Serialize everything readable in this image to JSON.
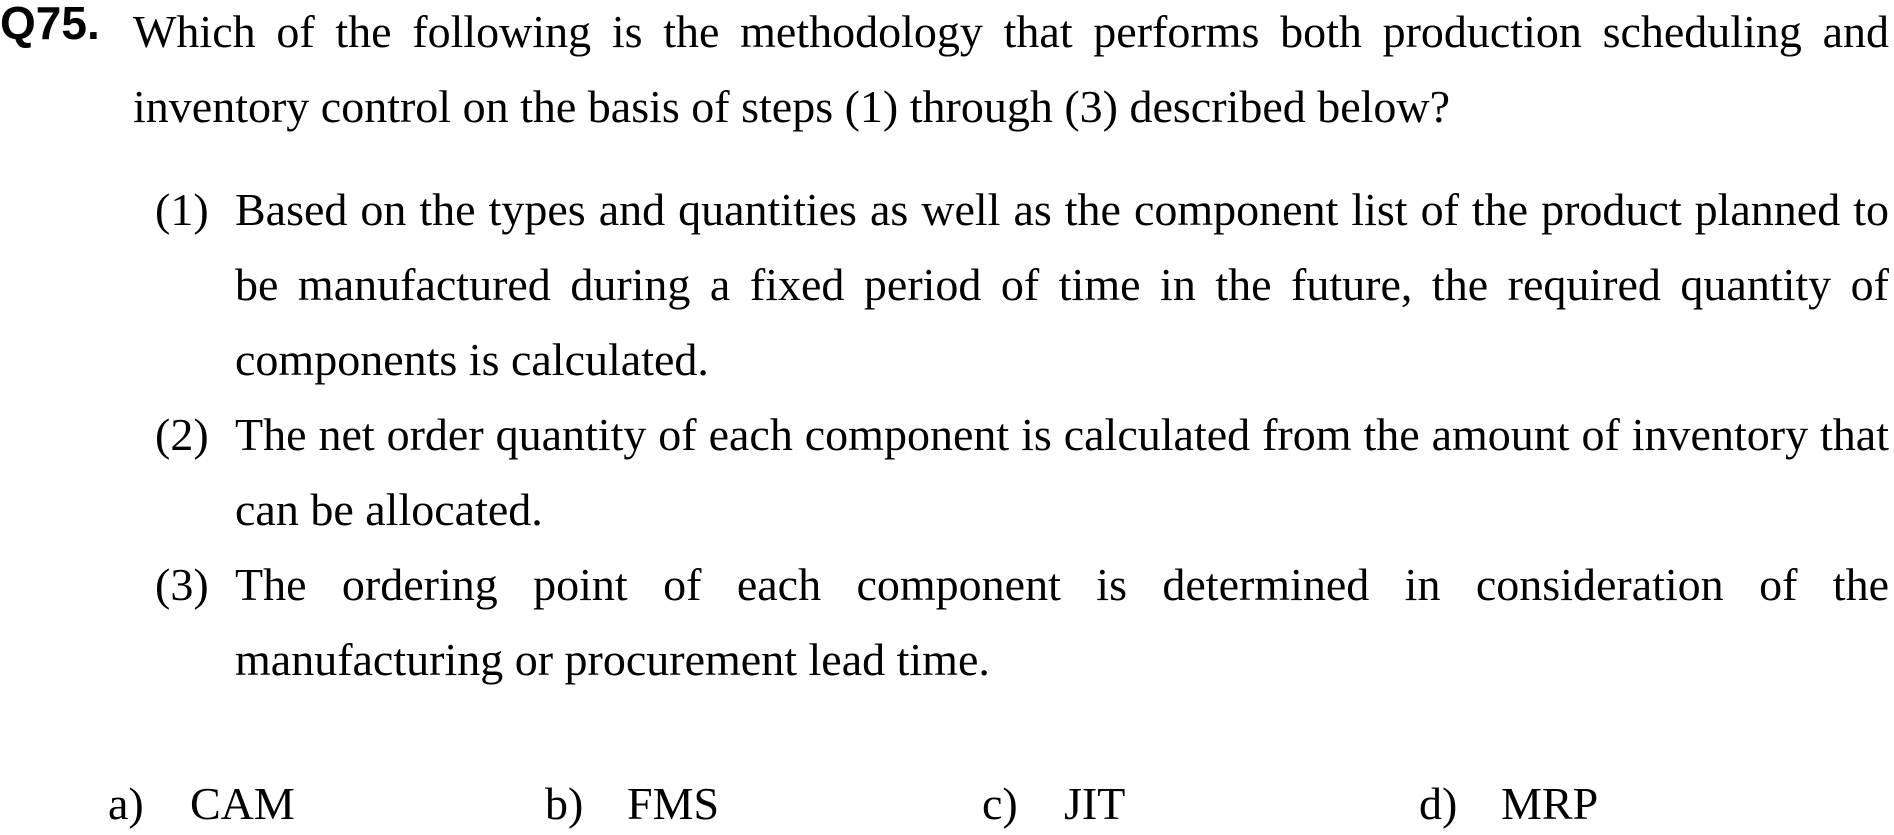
{
  "question": {
    "number": "Q75.",
    "stem": "Which of the following is the methodology that performs both production scheduling and inventory control on the basis of steps (1) through (3) described below?"
  },
  "steps": [
    {
      "marker": "(1)",
      "text": "Based on the types and quantities as well as the component list of the product planned to be manufactured during a fixed period of time in the future, the required quantity of components is calculated."
    },
    {
      "marker": "(2)",
      "text": "The net order quantity of each component is calculated from the amount of inventory that can be allocated."
    },
    {
      "marker": "(3)",
      "text": "The ordering point of each component is determined in consideration of the manufacturing or procurement lead time."
    }
  ],
  "choices": [
    {
      "letter": "a)",
      "text": "CAM"
    },
    {
      "letter": "b)",
      "text": "FMS"
    },
    {
      "letter": "c)",
      "text": "JIT"
    },
    {
      "letter": "d)",
      "text": "MRP"
    }
  ]
}
